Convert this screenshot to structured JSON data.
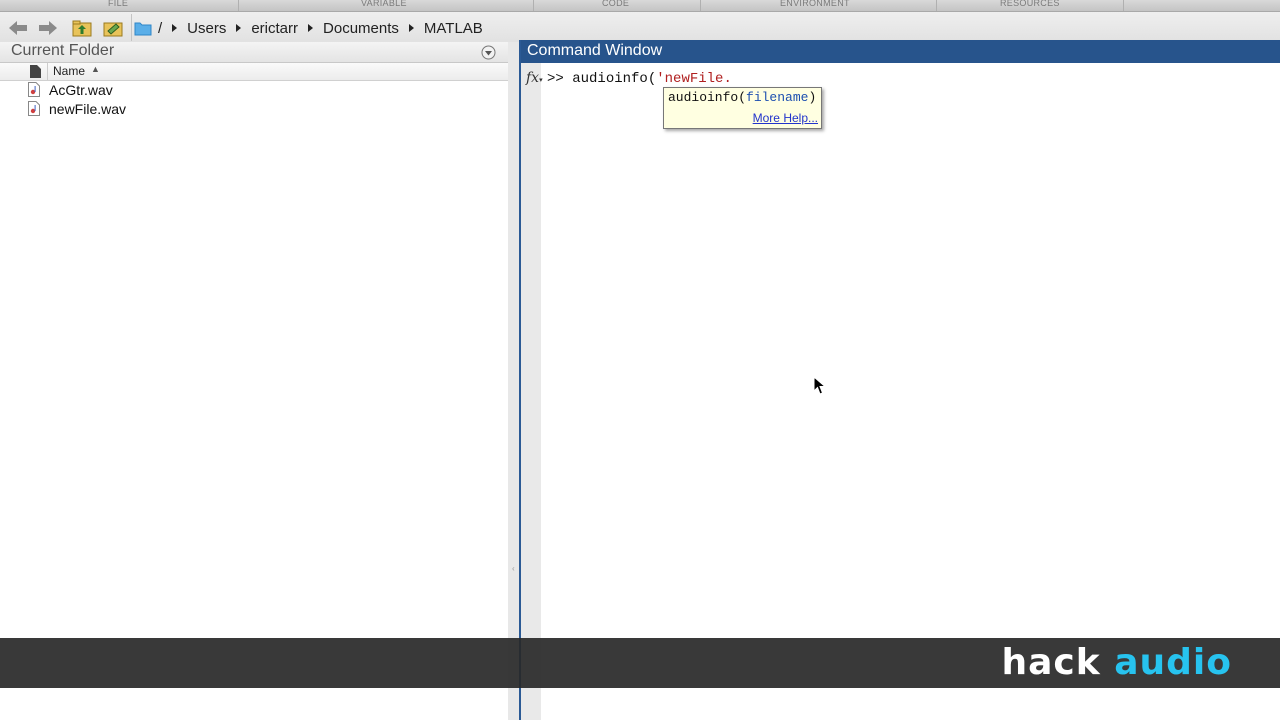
{
  "toolstrip": {
    "sections": [
      "FILE",
      "VARIABLE",
      "CODE",
      "ENVIRONMENT",
      "RESOURCES"
    ]
  },
  "address_bar": {
    "path": [
      "/",
      "Users",
      "erictarr",
      "Documents",
      "MATLAB"
    ],
    "icons": [
      "back-arrow-icon",
      "forward-arrow-icon",
      "up-folder-icon",
      "browse-folder-icon",
      "folder-icon"
    ]
  },
  "current_folder": {
    "title": "Current Folder",
    "column_name": "Name",
    "sort": "ascending",
    "files": [
      {
        "name": "AcGtr.wav",
        "icon": "audio-file-icon"
      },
      {
        "name": "newFile.wav",
        "icon": "audio-file-icon"
      }
    ]
  },
  "command_window": {
    "title": "Command Window",
    "prompt": ">>",
    "command_prefix": "audioinfo(",
    "command_string": "'newFile.",
    "tooltip": {
      "function": "audioinfo(",
      "argument": "filename",
      "close": ")",
      "help_link": "More Help..."
    }
  },
  "watermark": {
    "word1": "hack",
    "word2": "audio",
    "colors": {
      "word1": "#ffffff",
      "word2": "#27c3ef"
    }
  },
  "colors": {
    "command_title_bg": "#27548c",
    "tooltip_bg": "#ffffe1",
    "link": "#2233cc"
  }
}
